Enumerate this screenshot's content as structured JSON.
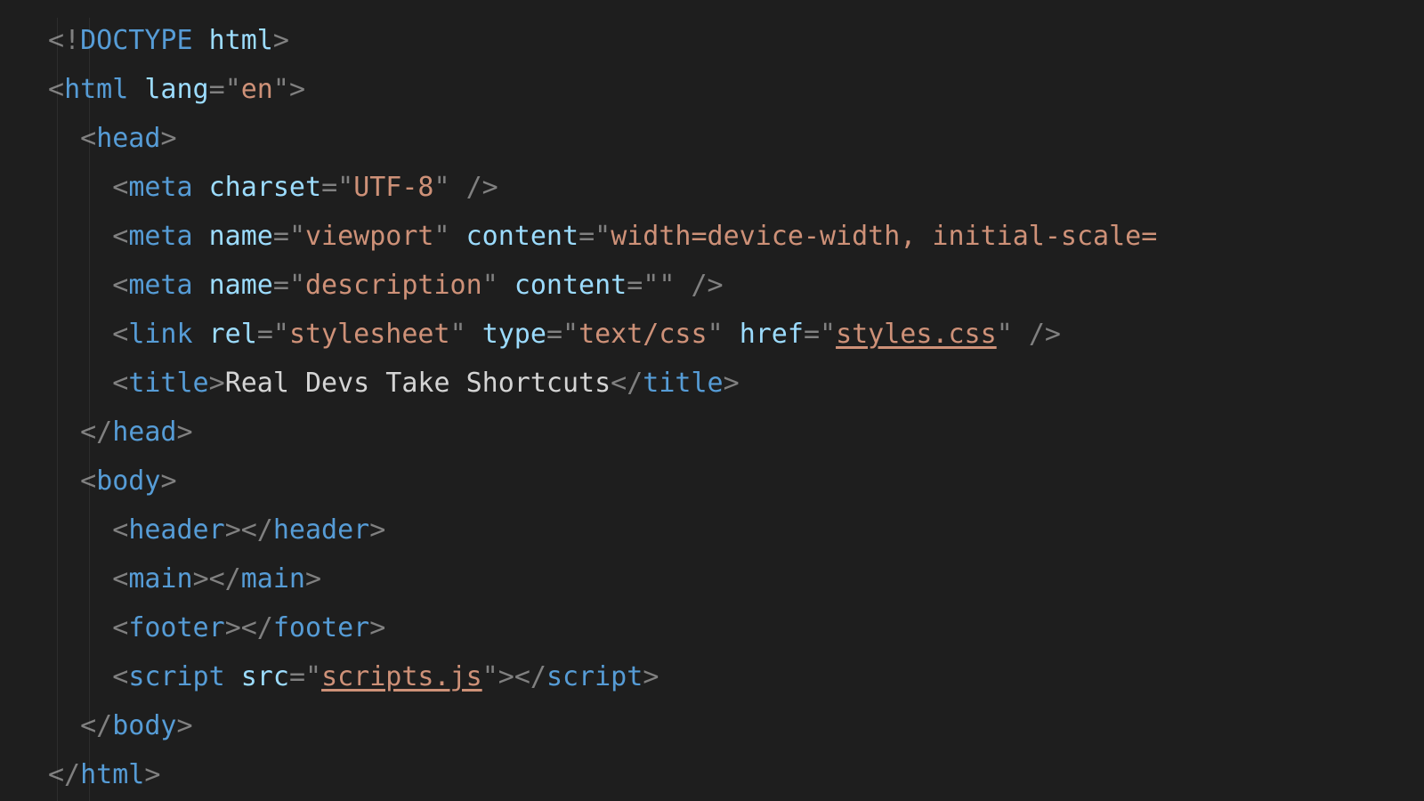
{
  "code": {
    "lines": [
      {
        "indent": 0,
        "tokens": [
          {
            "cls": "p",
            "t": "<!"
          },
          {
            "cls": "kw",
            "t": "DOCTYPE"
          },
          {
            "cls": "tx",
            "t": " "
          },
          {
            "cls": "at",
            "t": "html"
          },
          {
            "cls": "p",
            "t": ">"
          }
        ]
      },
      {
        "indent": 0,
        "tokens": [
          {
            "cls": "p",
            "t": "<"
          },
          {
            "cls": "tag",
            "t": "html"
          },
          {
            "cls": "tx",
            "t": " "
          },
          {
            "cls": "at",
            "t": "lang"
          },
          {
            "cls": "p",
            "t": "="
          },
          {
            "cls": "p",
            "t": "\""
          },
          {
            "cls": "st",
            "t": "en"
          },
          {
            "cls": "p",
            "t": "\""
          },
          {
            "cls": "p",
            "t": ">"
          }
        ]
      },
      {
        "indent": 1,
        "tokens": [
          {
            "cls": "p",
            "t": "<"
          },
          {
            "cls": "tag",
            "t": "head"
          },
          {
            "cls": "p",
            "t": ">"
          }
        ]
      },
      {
        "indent": 2,
        "tokens": [
          {
            "cls": "p",
            "t": "<"
          },
          {
            "cls": "tag",
            "t": "meta"
          },
          {
            "cls": "tx",
            "t": " "
          },
          {
            "cls": "at",
            "t": "charset"
          },
          {
            "cls": "p",
            "t": "="
          },
          {
            "cls": "p",
            "t": "\""
          },
          {
            "cls": "st",
            "t": "UTF-8"
          },
          {
            "cls": "p",
            "t": "\""
          },
          {
            "cls": "tx",
            "t": " "
          },
          {
            "cls": "p",
            "t": "/>"
          }
        ]
      },
      {
        "indent": 2,
        "tokens": [
          {
            "cls": "p",
            "t": "<"
          },
          {
            "cls": "tag",
            "t": "meta"
          },
          {
            "cls": "tx",
            "t": " "
          },
          {
            "cls": "at",
            "t": "name"
          },
          {
            "cls": "p",
            "t": "="
          },
          {
            "cls": "p",
            "t": "\""
          },
          {
            "cls": "st",
            "t": "viewport"
          },
          {
            "cls": "p",
            "t": "\""
          },
          {
            "cls": "tx",
            "t": " "
          },
          {
            "cls": "at",
            "t": "content"
          },
          {
            "cls": "p",
            "t": "="
          },
          {
            "cls": "p",
            "t": "\""
          },
          {
            "cls": "st",
            "t": "width=device-width, initial-scale="
          }
        ]
      },
      {
        "indent": 2,
        "tokens": [
          {
            "cls": "p",
            "t": "<"
          },
          {
            "cls": "tag",
            "t": "meta"
          },
          {
            "cls": "tx",
            "t": " "
          },
          {
            "cls": "at",
            "t": "name"
          },
          {
            "cls": "p",
            "t": "="
          },
          {
            "cls": "p",
            "t": "\""
          },
          {
            "cls": "st",
            "t": "description"
          },
          {
            "cls": "p",
            "t": "\""
          },
          {
            "cls": "tx",
            "t": " "
          },
          {
            "cls": "at",
            "t": "content"
          },
          {
            "cls": "p",
            "t": "="
          },
          {
            "cls": "p",
            "t": "\""
          },
          {
            "cls": "st",
            "t": ""
          },
          {
            "cls": "p",
            "t": "\""
          },
          {
            "cls": "tx",
            "t": " "
          },
          {
            "cls": "p",
            "t": "/>"
          }
        ]
      },
      {
        "indent": 2,
        "tokens": [
          {
            "cls": "p",
            "t": "<"
          },
          {
            "cls": "tag",
            "t": "link"
          },
          {
            "cls": "tx",
            "t": " "
          },
          {
            "cls": "at",
            "t": "rel"
          },
          {
            "cls": "p",
            "t": "="
          },
          {
            "cls": "p",
            "t": "\""
          },
          {
            "cls": "st",
            "t": "stylesheet"
          },
          {
            "cls": "p",
            "t": "\""
          },
          {
            "cls": "tx",
            "t": " "
          },
          {
            "cls": "at",
            "t": "type"
          },
          {
            "cls": "p",
            "t": "="
          },
          {
            "cls": "p",
            "t": "\""
          },
          {
            "cls": "st",
            "t": "text/css"
          },
          {
            "cls": "p",
            "t": "\""
          },
          {
            "cls": "tx",
            "t": " "
          },
          {
            "cls": "at",
            "t": "href"
          },
          {
            "cls": "p",
            "t": "="
          },
          {
            "cls": "p",
            "t": "\""
          },
          {
            "cls": "stlink",
            "t": "styles.css"
          },
          {
            "cls": "p",
            "t": "\""
          },
          {
            "cls": "tx",
            "t": " "
          },
          {
            "cls": "p",
            "t": "/>"
          }
        ]
      },
      {
        "indent": 2,
        "tokens": [
          {
            "cls": "p",
            "t": "<"
          },
          {
            "cls": "tag",
            "t": "title"
          },
          {
            "cls": "p",
            "t": ">"
          },
          {
            "cls": "tx",
            "t": "Real Devs Take Shortcuts"
          },
          {
            "cls": "p",
            "t": "</"
          },
          {
            "cls": "tag",
            "t": "title"
          },
          {
            "cls": "p",
            "t": ">"
          }
        ]
      },
      {
        "indent": 1,
        "tokens": [
          {
            "cls": "p",
            "t": "</"
          },
          {
            "cls": "tag",
            "t": "head"
          },
          {
            "cls": "p",
            "t": ">"
          }
        ]
      },
      {
        "indent": 1,
        "tokens": [
          {
            "cls": "p",
            "t": "<"
          },
          {
            "cls": "tag",
            "t": "body"
          },
          {
            "cls": "p",
            "t": ">"
          }
        ]
      },
      {
        "indent": 2,
        "tokens": [
          {
            "cls": "p",
            "t": "<"
          },
          {
            "cls": "tag",
            "t": "header"
          },
          {
            "cls": "p",
            "t": ">"
          },
          {
            "cls": "p",
            "t": "</"
          },
          {
            "cls": "tag",
            "t": "header"
          },
          {
            "cls": "p",
            "t": ">"
          }
        ]
      },
      {
        "indent": 2,
        "tokens": [
          {
            "cls": "p",
            "t": "<"
          },
          {
            "cls": "tag",
            "t": "main"
          },
          {
            "cls": "p",
            "t": ">"
          },
          {
            "cls": "p",
            "t": "</"
          },
          {
            "cls": "tag",
            "t": "main"
          },
          {
            "cls": "p",
            "t": ">"
          }
        ]
      },
      {
        "indent": 2,
        "tokens": [
          {
            "cls": "p",
            "t": "<"
          },
          {
            "cls": "tag",
            "t": "footer"
          },
          {
            "cls": "p",
            "t": ">"
          },
          {
            "cls": "p",
            "t": "</"
          },
          {
            "cls": "tag",
            "t": "footer"
          },
          {
            "cls": "p",
            "t": ">"
          }
        ]
      },
      {
        "indent": 2,
        "tokens": [
          {
            "cls": "p",
            "t": "<"
          },
          {
            "cls": "tag",
            "t": "script"
          },
          {
            "cls": "tx",
            "t": " "
          },
          {
            "cls": "at",
            "t": "src"
          },
          {
            "cls": "p",
            "t": "="
          },
          {
            "cls": "p",
            "t": "\""
          },
          {
            "cls": "stlink",
            "t": "scripts.js"
          },
          {
            "cls": "p",
            "t": "\""
          },
          {
            "cls": "p",
            "t": ">"
          },
          {
            "cls": "p",
            "t": "</"
          },
          {
            "cls": "tag",
            "t": "script"
          },
          {
            "cls": "p",
            "t": ">"
          }
        ]
      },
      {
        "indent": 1,
        "tokens": [
          {
            "cls": "p",
            "t": "</"
          },
          {
            "cls": "tag",
            "t": "body"
          },
          {
            "cls": "p",
            "t": ">"
          }
        ]
      },
      {
        "indent": 0,
        "tokens": [
          {
            "cls": "p",
            "t": "</"
          },
          {
            "cls": "tag",
            "t": "html"
          },
          {
            "cls": "p",
            "t": ">"
          }
        ]
      }
    ]
  },
  "indentUnit": "  ",
  "colors": {
    "background": "#1e1e1e",
    "punctuation": "#808080",
    "tag": "#569cd6",
    "attribute": "#9cdcfe",
    "string": "#ce9178",
    "text": "#d4d4d4"
  }
}
